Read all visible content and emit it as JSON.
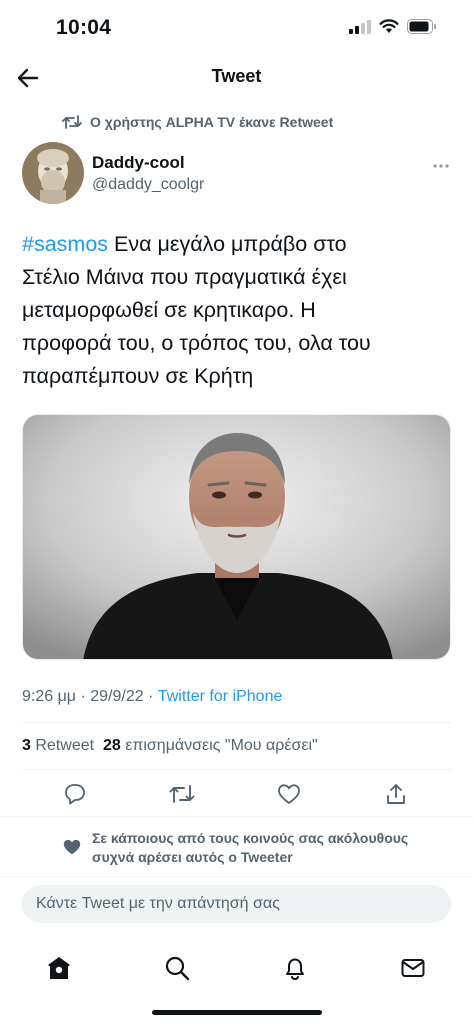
{
  "status_bar": {
    "time": "10:04"
  },
  "nav": {
    "title": "Tweet"
  },
  "retweet_note": "Ο χρήστης ALPHA TV έκανε Retweet",
  "author": {
    "name": "Daddy-cool",
    "handle": "@daddy_coolgr"
  },
  "tweet": {
    "hashtag": "#sasmos",
    "text": " Ενα μεγάλο μπράβο στο\nΣτέλιο Μάινα  που πραγματικά έχει\nμεταμορφωθεί σε κρητικαρο. Η\nπροφορά του, ο τρόπος του, ολα του\nπαραπέμπουν σε Κρήτη"
  },
  "meta": {
    "time": "9:26 μμ",
    "separator": " · ",
    "date": "29/9/22",
    "source": "Twitter for iPhone"
  },
  "counts": {
    "retweets": "3",
    "retweets_label": "Retweet",
    "likes": "28",
    "likes_label": "επισημάνσεις \"Μου αρέσει\""
  },
  "social_context": "Σε κάποιους από τους κοινούς σας ακόλουθους συχνά αρέσει αυτός ο Tweeter",
  "reply": {
    "placeholder": "Κάντε Tweet με την απάντησή σας"
  },
  "icons": {
    "back": "arrow-left-icon",
    "retweet": "retweet-icon",
    "more": "more-dots-icon",
    "reply": "reply-icon",
    "like": "heart-icon",
    "share": "share-icon",
    "home": "home-icon",
    "search": "search-icon",
    "notifications": "bell-icon",
    "messages": "mail-icon"
  },
  "colors": {
    "accent": "#1d9bf0",
    "text": "#0f1419",
    "secondary": "#536471"
  }
}
